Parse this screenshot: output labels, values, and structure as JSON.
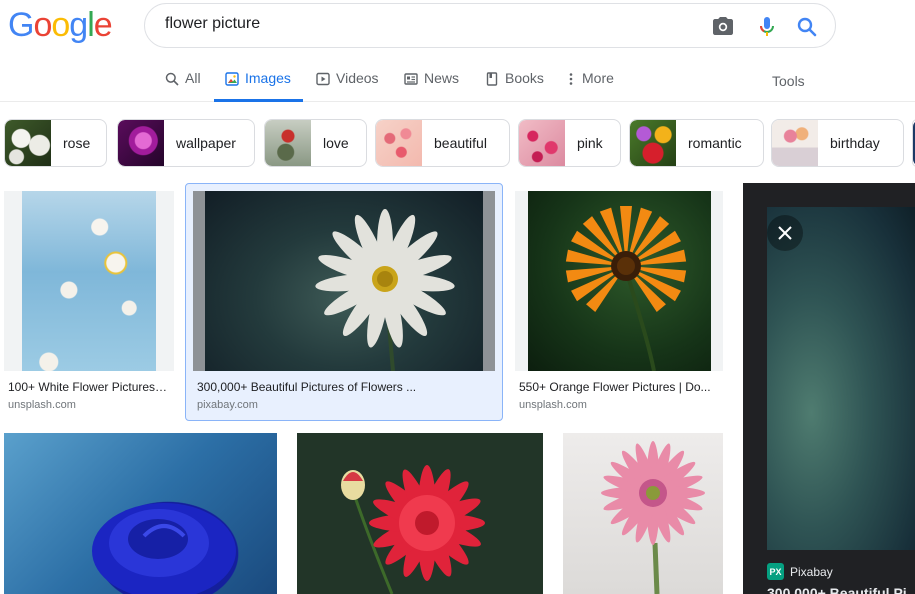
{
  "search": {
    "query": "flower picture"
  },
  "tabs": [
    {
      "label": "All"
    },
    {
      "label": "Images"
    },
    {
      "label": "Videos"
    },
    {
      "label": "News"
    },
    {
      "label": "Books"
    },
    {
      "label": "More"
    }
  ],
  "tools_label": "Tools",
  "chips": [
    {
      "label": "rose"
    },
    {
      "label": "wallpaper"
    },
    {
      "label": "love"
    },
    {
      "label": "beautiful"
    },
    {
      "label": "pink"
    },
    {
      "label": "romantic"
    },
    {
      "label": "birthday"
    }
  ],
  "results": [
    {
      "title": "100+ White Flower Pictures…",
      "source": "unsplash.com"
    },
    {
      "title": "300,000+ Beautiful Pictures of Flowers ...",
      "source": "pixabay.com"
    },
    {
      "title": "550+ Orange Flower Pictures | Do...",
      "source": "unsplash.com"
    }
  ],
  "preview": {
    "source": "Pixabay",
    "title": "300,000+ Beautiful Pi",
    "logo_text": "PX"
  },
  "colors": {
    "accent": "#1a73e8",
    "text_secondary": "#5f6368",
    "border": "#dfe1e5"
  }
}
